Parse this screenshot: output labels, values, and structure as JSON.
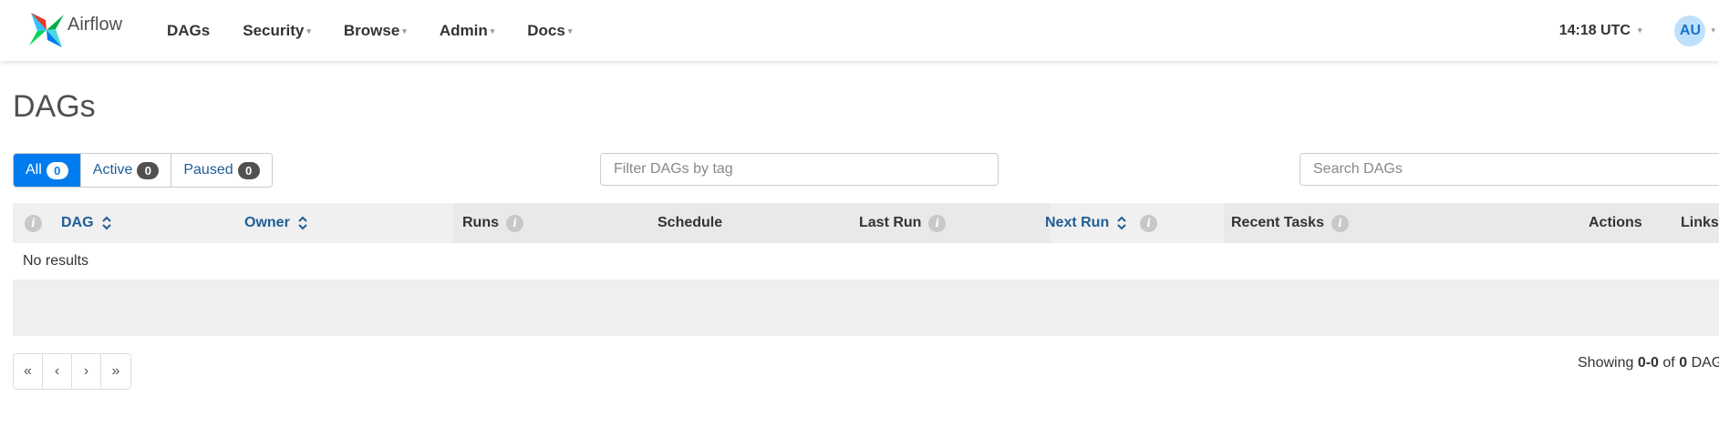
{
  "navbar": {
    "brand": "Airflow",
    "items": [
      {
        "label": "DAGs",
        "dropdown": false
      },
      {
        "label": "Security",
        "dropdown": true
      },
      {
        "label": "Browse",
        "dropdown": true
      },
      {
        "label": "Admin",
        "dropdown": true
      },
      {
        "label": "Docs",
        "dropdown": true
      }
    ],
    "clock": "14:18 UTC",
    "avatar_initials": "AU"
  },
  "page": {
    "title": "DAGs"
  },
  "filters": {
    "status_buttons": [
      {
        "label": "All",
        "count": "0",
        "active": true
      },
      {
        "label": "Active",
        "count": "0",
        "active": false
      },
      {
        "label": "Paused",
        "count": "0",
        "active": false
      }
    ],
    "tag_placeholder": "Filter DAGs by tag",
    "search_placeholder": "Search DAGs"
  },
  "table": {
    "columns": [
      {
        "label": "DAG",
        "sortable": true,
        "info": false
      },
      {
        "label": "Owner",
        "sortable": true,
        "info": false
      },
      {
        "label": "Runs",
        "sortable": false,
        "info": true
      },
      {
        "label": "Schedule",
        "sortable": false,
        "info": false
      },
      {
        "label": "Last Run",
        "sortable": false,
        "info": true
      },
      {
        "label": "Next Run",
        "sortable": true,
        "info": true
      },
      {
        "label": "Recent Tasks",
        "sortable": false,
        "info": true
      },
      {
        "label": "Actions",
        "sortable": false,
        "info": false
      },
      {
        "label": "Links",
        "sortable": false,
        "info": false
      }
    ],
    "empty_message": "No results"
  },
  "pagination": {
    "first": "«",
    "prev": "‹",
    "next": "›",
    "last": "»",
    "showing_prefix": "Showing",
    "range": "0-0",
    "of_text": "of",
    "total": "0",
    "unit": "DAGs"
  },
  "colors": {
    "accent": "#017cee",
    "link": "#1f5d96"
  }
}
